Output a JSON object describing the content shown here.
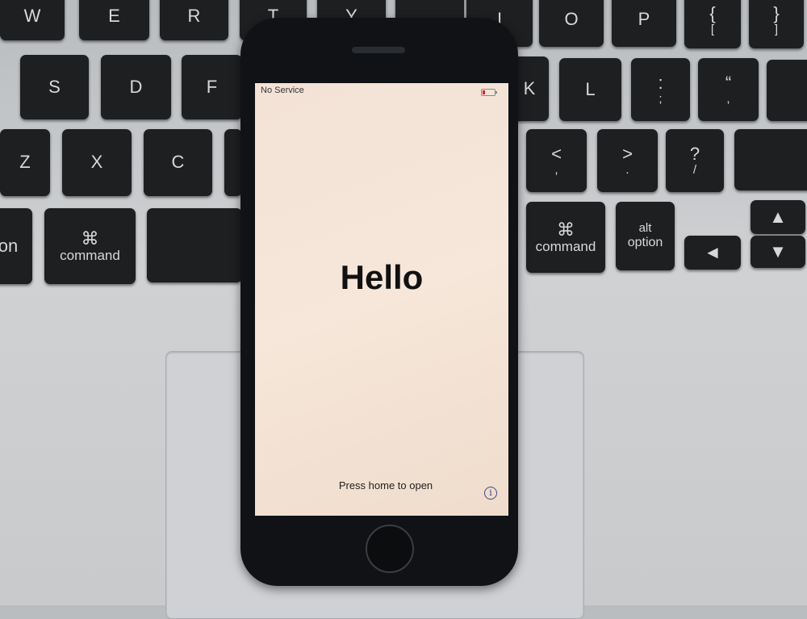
{
  "keyboard": {
    "keys": [
      {
        "main": "W",
        "sub": ""
      },
      {
        "main": "E",
        "sub": ""
      },
      {
        "main": "R",
        "sub": ""
      },
      {
        "main": "T",
        "sub": ""
      },
      {
        "main": "Y",
        "sub": ""
      },
      {
        "main": "",
        "sub": ""
      },
      {
        "main": "I",
        "sub": ""
      },
      {
        "main": "O",
        "sub": ""
      },
      {
        "main": "P",
        "sub": ""
      },
      {
        "main": "{",
        "sub": "["
      },
      {
        "main": "}",
        "sub": "]"
      },
      {
        "main": "S",
        "sub": ""
      },
      {
        "main": "D",
        "sub": ""
      },
      {
        "main": "F",
        "sub": ""
      },
      {
        "main": "K",
        "sub": ""
      },
      {
        "main": "L",
        "sub": ""
      },
      {
        "main": ":",
        "sub": ";"
      },
      {
        "main": "“",
        "sub": ","
      },
      {
        "main": "",
        "sub": ""
      },
      {
        "main": "Z",
        "sub": ""
      },
      {
        "main": "X",
        "sub": ""
      },
      {
        "main": "C",
        "sub": ""
      },
      {
        "main": "",
        "sub": ""
      },
      {
        "main": "<",
        "sub": ","
      },
      {
        "main": ">",
        "sub": "."
      },
      {
        "main": "?",
        "sub": "/"
      },
      {
        "main": "",
        "sub": ""
      },
      {
        "main": "on",
        "sub": ""
      },
      {
        "main": "⌘",
        "sub": "command"
      },
      {
        "main": "",
        "sub": ""
      },
      {
        "main": "⌘",
        "sub": "command"
      },
      {
        "main": "alt",
        "sub": "option"
      },
      {
        "main": "◄",
        "sub": ""
      },
      {
        "main": "▲",
        "sub": ""
      },
      {
        "main": "▼",
        "sub": ""
      }
    ]
  },
  "phone": {
    "status_bar": {
      "carrier": "No Service",
      "battery_icon": "battery-low-icon",
      "battery_color": "#e02020"
    },
    "greeting": "Hello",
    "prompt": "Press home to open",
    "info_icon": "i"
  }
}
